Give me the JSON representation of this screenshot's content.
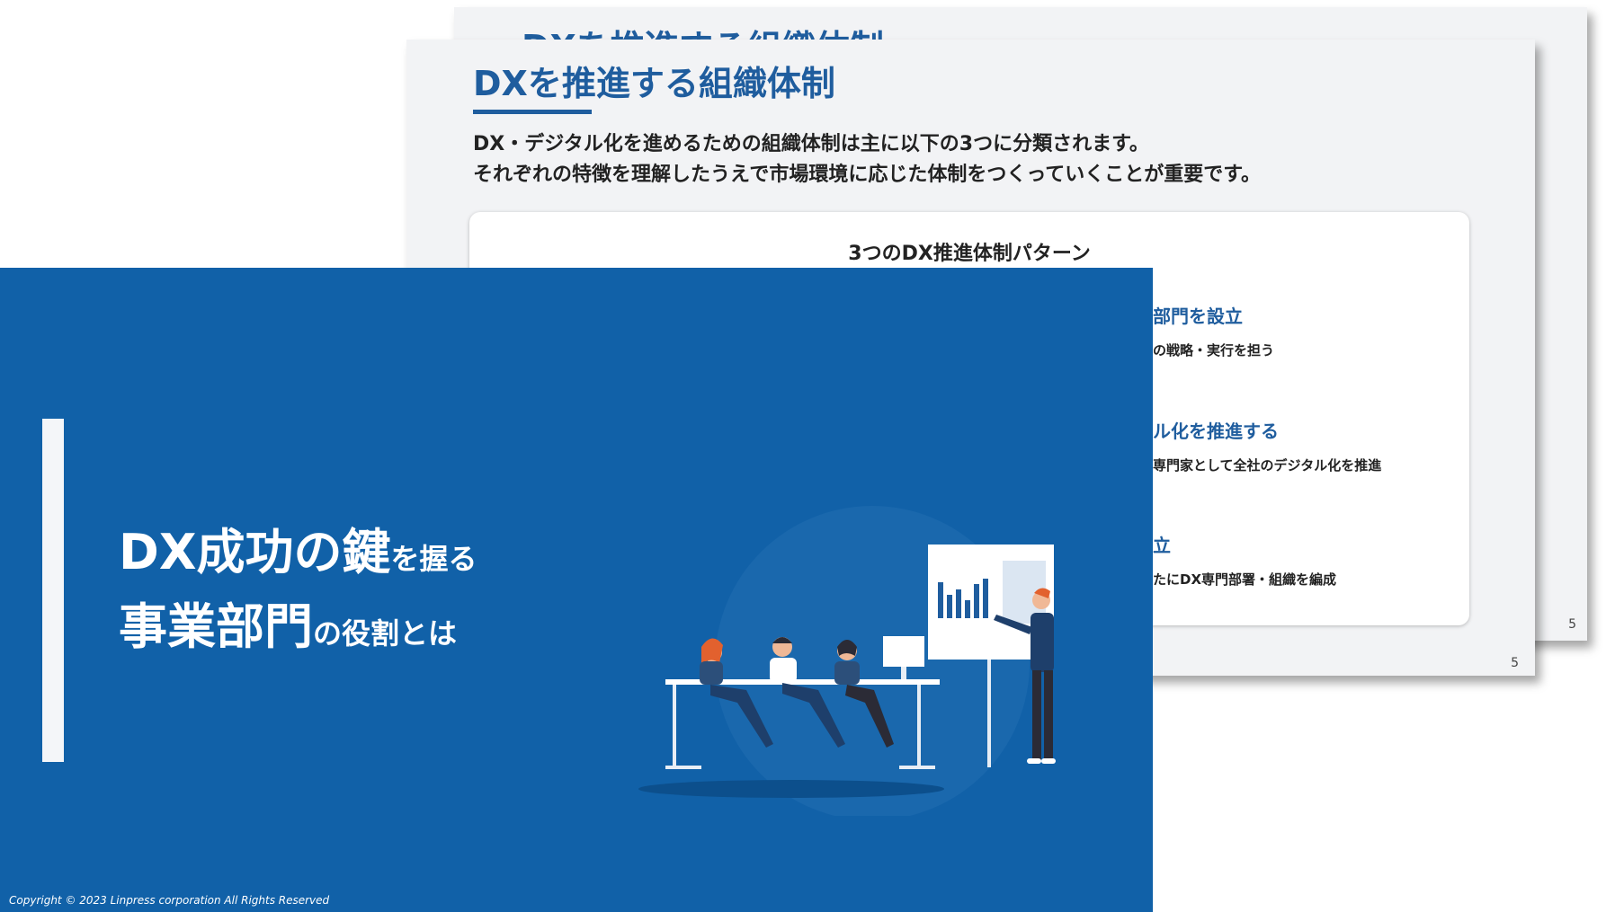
{
  "back_slide": {
    "title": "DXを推進する組織体制",
    "page_number": "5"
  },
  "middle_slide": {
    "title": "DXを推進する組織体制",
    "lead_line_1": "DX・デジタル化を進めるための組織体制は主に以下の3つに分類されます。",
    "lead_line_2": "それぞれの特徴を理解したうえで市場環境に応じた体制をつくっていくことが重要です。",
    "panel_title": "3つのDX推進体制パターン",
    "patterns": [
      {
        "heading": "部門を設立",
        "desc": "の戦略・実行を担う"
      },
      {
        "heading": "ル化を推進する",
        "desc": "専門家として全社のデジタル化を推進"
      },
      {
        "heading": "立",
        "desc": "たにDX専門部署・組織を編成"
      }
    ],
    "page_number": "5"
  },
  "cover_slide": {
    "title_line1_big": "DX成功の鍵",
    "title_line1_small": "を握る",
    "title_line2_big": "事業部門",
    "title_line2_small": "の役割とは",
    "copyright": "Copyright © 2023 Linpress corporation All Rights Reserved"
  },
  "colors": {
    "cover_bg": "#1161a8",
    "title_blue": "#1f5d9e",
    "slide_bg": "#f2f3f5"
  }
}
